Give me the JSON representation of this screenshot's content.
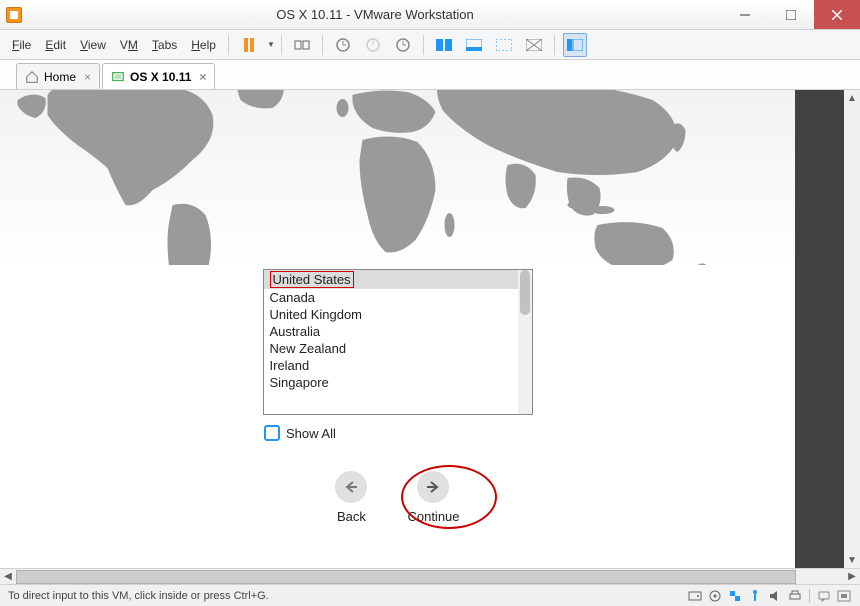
{
  "window": {
    "title": "OS X 10.11 - VMware Workstation"
  },
  "menu": {
    "file": "File",
    "edit": "Edit",
    "view": "View",
    "vm": "VM",
    "tabs": "Tabs",
    "help": "Help"
  },
  "tabs": {
    "home": "Home",
    "osx": "OS X 10.11"
  },
  "countries": [
    "United States",
    "Canada",
    "United Kingdom",
    "Australia",
    "New Zealand",
    "Ireland",
    "Singapore"
  ],
  "show_all_label": "Show All",
  "nav": {
    "back": "Back",
    "continue": "Continue"
  },
  "status": {
    "hint": "To direct input to this VM, click inside or press Ctrl+G."
  }
}
